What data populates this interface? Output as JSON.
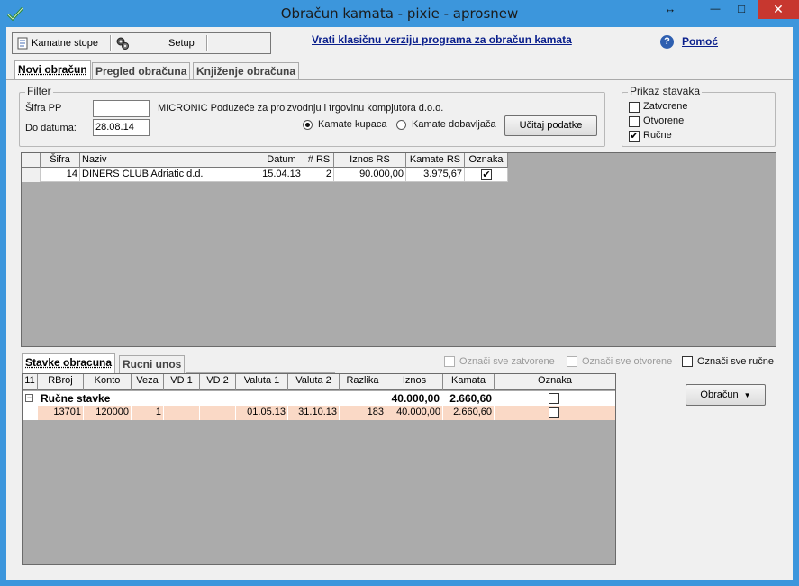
{
  "window": {
    "title": "Obračun kamata - pixie - aprosnew",
    "controls": {
      "resize": "↔",
      "minimize": "—",
      "maximize": "□",
      "close": "✕"
    }
  },
  "toolbar": {
    "interest_rates_label": "Kamatne stope",
    "setup_label": "Setup"
  },
  "classic_link": "Vrati klasičnu verziju programa za obračun kamata",
  "help_label": "Pomoć",
  "tabs": [
    "Novi obračun",
    "Pregled obračuna",
    "Knjiženje obračuna"
  ],
  "filter": {
    "legend": "Filter",
    "sifra_label": "Šifra PP",
    "sifra_value": "",
    "company_name": "MICRONIC  Poduzeće za proizvodnju i trgovinu kompjutora d.o.o.",
    "date_label": "Do datuma:",
    "date_value": "28.08.14",
    "radio_customers": "Kamate kupaca",
    "radio_suppliers": "Kamate dobavljača",
    "load_button": "Učitaj podatke"
  },
  "display": {
    "legend": "Prikaz stavaka",
    "closed": "Zatvorene",
    "open": "Otvorene",
    "manual": "Ručne",
    "manual_check": "✔"
  },
  "top_grid": {
    "headers": [
      "Šifra",
      "Naziv",
      "Datum",
      "# RS",
      "Iznos RS",
      "Kamate RS",
      "Oznaka"
    ],
    "rows": [
      {
        "sifra": "14",
        "naziv": "DINERS CLUB Adriatic d.d.",
        "datum": "15.04.13",
        "rs": "2",
        "iznos": "90.000,00",
        "kamate": "3.975,67",
        "oznaka": "✔"
      }
    ]
  },
  "bottom_tabs": [
    "Stavke obracuna",
    "Rucni unos"
  ],
  "mark_options": {
    "closed": "Označi sve zatvorene",
    "open": "Označi sve otvorene",
    "manual": "Označi sve ručne"
  },
  "bottom_grid": {
    "corner": "11",
    "headers": [
      "RBroj",
      "Konto",
      "Veza",
      "VD 1",
      "VD 2",
      "Valuta 1",
      "Valuta 2",
      "Razlika",
      "Iznos",
      "Kamata",
      "Oznaka"
    ],
    "group": {
      "toggle": "−",
      "label": "Ručne stavke",
      "iznos": "40.000,00",
      "kamata": "2.660,60"
    },
    "rows": [
      {
        "rbroj": "13701",
        "konto": "120000",
        "veza": "1",
        "vd1": "",
        "vd2": "",
        "valuta1": "01.05.13",
        "valuta2": "31.10.13",
        "razlika": "183",
        "iznos": "40.000,00",
        "kamata": "2.660,60"
      }
    ]
  },
  "calc_button": "Obračun",
  "calc_arrow": "▼"
}
